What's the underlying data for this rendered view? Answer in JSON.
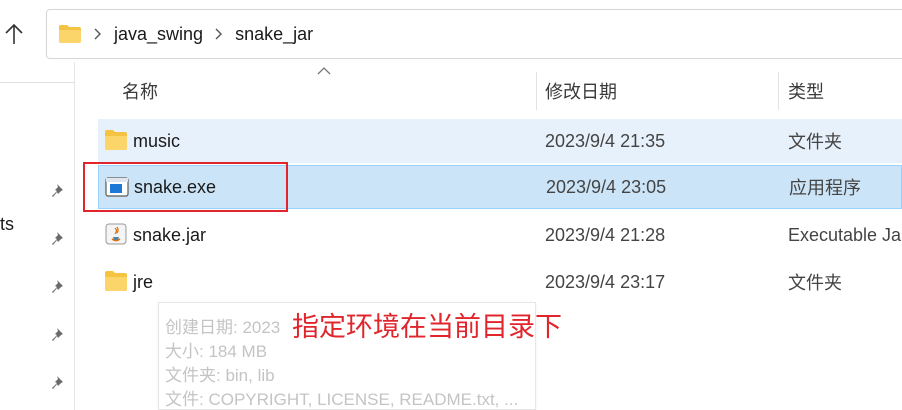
{
  "nav": {
    "up_icon": "arrow-up-icon"
  },
  "address_bar": {
    "breadcrumbs": [
      "java_swing",
      "snake_jar"
    ]
  },
  "left_pane": {
    "partial_label": "ts"
  },
  "columns": {
    "name": "名称",
    "date_modified": "修改日期",
    "type": "类型"
  },
  "files": [
    {
      "name": "music",
      "date": "2023/9/4 21:35",
      "type": "文件夹",
      "icon": "folder-icon"
    },
    {
      "name": "snake.exe",
      "date": "2023/9/4 23:05",
      "type": "应用程序",
      "icon": "exe-icon"
    },
    {
      "name": "snake.jar",
      "date": "2023/9/4 21:28",
      "type": "Executable Jar File",
      "icon": "java-jar-icon"
    },
    {
      "name": "jre",
      "date": "2023/9/4 23:17",
      "type": "文件夹",
      "icon": "folder-icon"
    }
  ],
  "tooltip": {
    "line1": "创建日期: 2023",
    "line2": "大小: 184 MB",
    "line3": "文件夹: bin, lib",
    "line4": "文件: COPYRIGHT, LICENSE, README.txt, ..."
  },
  "annotation": {
    "text": "指定环境在当前目录下",
    "color": "#e0262c"
  },
  "colors": {
    "selection": "#cce4f7",
    "hover": "#e7f1fb",
    "folder": "#f5c342"
  }
}
